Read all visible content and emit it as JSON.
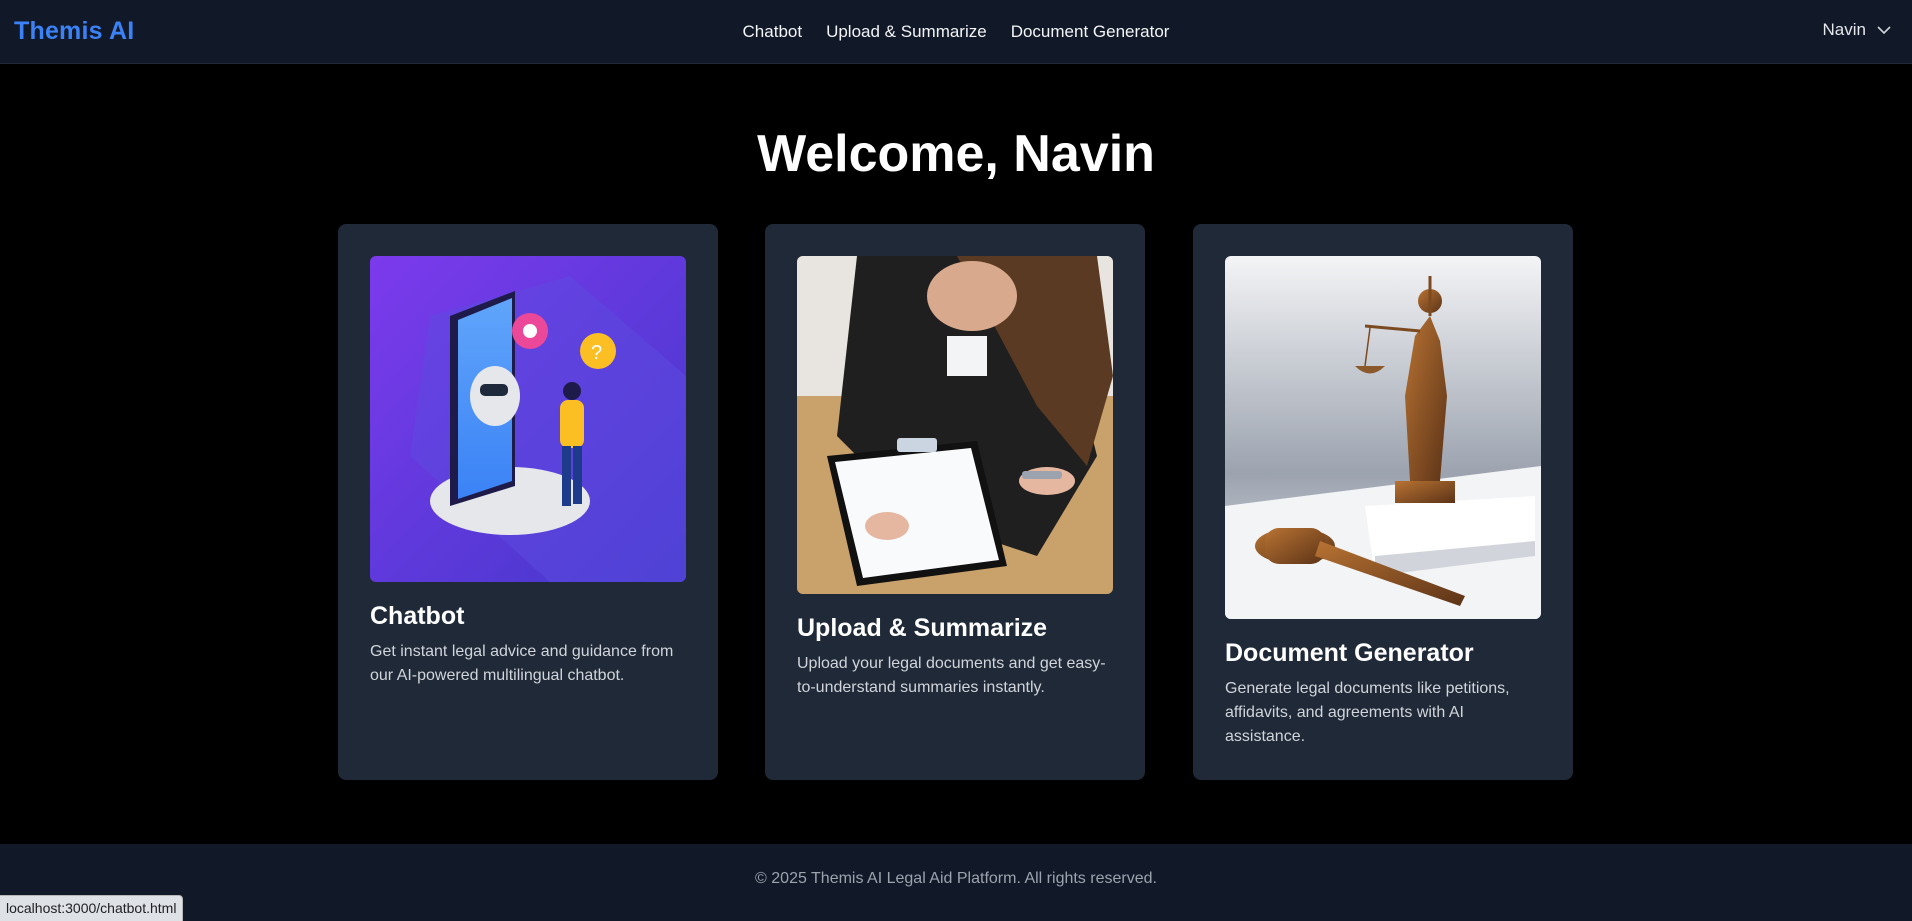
{
  "app": {
    "brand": "Themis AI"
  },
  "nav": {
    "links": [
      {
        "label": "Chatbot"
      },
      {
        "label": "Upload & Summarize"
      },
      {
        "label": "Document Generator"
      }
    ],
    "user": {
      "name": "Navin",
      "icon": "chevron-down-icon"
    }
  },
  "hero": {
    "title": "Welcome, Navin"
  },
  "cards": [
    {
      "title": "Chatbot",
      "description": "Get instant legal advice and guidance from our AI-powered multilingual chatbot.",
      "image": "chatbot-illustration"
    },
    {
      "title": "Upload & Summarize",
      "description": "Upload your legal documents and get easy-to-understand summaries instantly.",
      "image": "woman-writing-on-clipboard-photo"
    },
    {
      "title": "Document Generator",
      "description": "Generate legal documents like petitions, affidavits, and agreements with AI assistance.",
      "image": "lady-justice-statue-and-gavel-photo"
    }
  ],
  "footer": {
    "text": "© 2025 Themis AI Legal Aid Platform. All rights reserved."
  },
  "status_bar": {
    "url": "localhost:3000/chatbot.html"
  },
  "colors": {
    "brand": "#3b82f6",
    "nav_bg": "#111827",
    "card_bg": "#1f2937",
    "page_bg": "#000000"
  }
}
